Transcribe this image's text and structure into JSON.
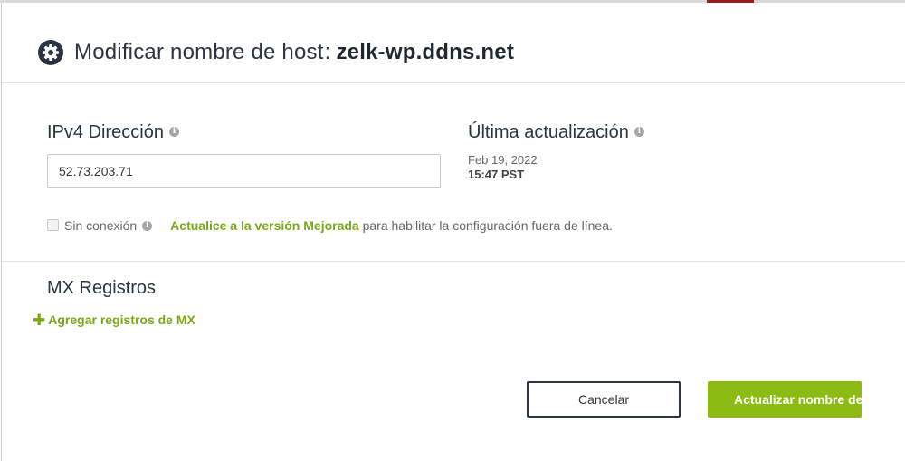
{
  "dialog": {
    "title_prefix": "Modificar nombre de host",
    "title_colon": ":",
    "hostname": "zelk-wp.ddns.net"
  },
  "ipv4": {
    "label": "IPv4 Dirección",
    "value": "52.73.203.71"
  },
  "last_update": {
    "label": "Última actualización",
    "date": "Feb 19, 2022",
    "time": "15:47 PST"
  },
  "offline": {
    "checked": false,
    "label": "Sin conexión",
    "upgrade_link": "Actualice a la versión Mejorada",
    "upgrade_text": "para habilitar la configuración fuera de línea."
  },
  "mx": {
    "title": "MX Registros",
    "add_label": "Agregar registros de MX"
  },
  "buttons": {
    "cancel": "Cancelar",
    "update": "Actualizar nombre de host"
  },
  "icons": {
    "title": "gear-icon",
    "info": "info-icon",
    "add": "plus-icon"
  },
  "colors": {
    "accent_green": "#8cbb12",
    "link_green": "#7aa818",
    "title_text": "#2b3440"
  }
}
